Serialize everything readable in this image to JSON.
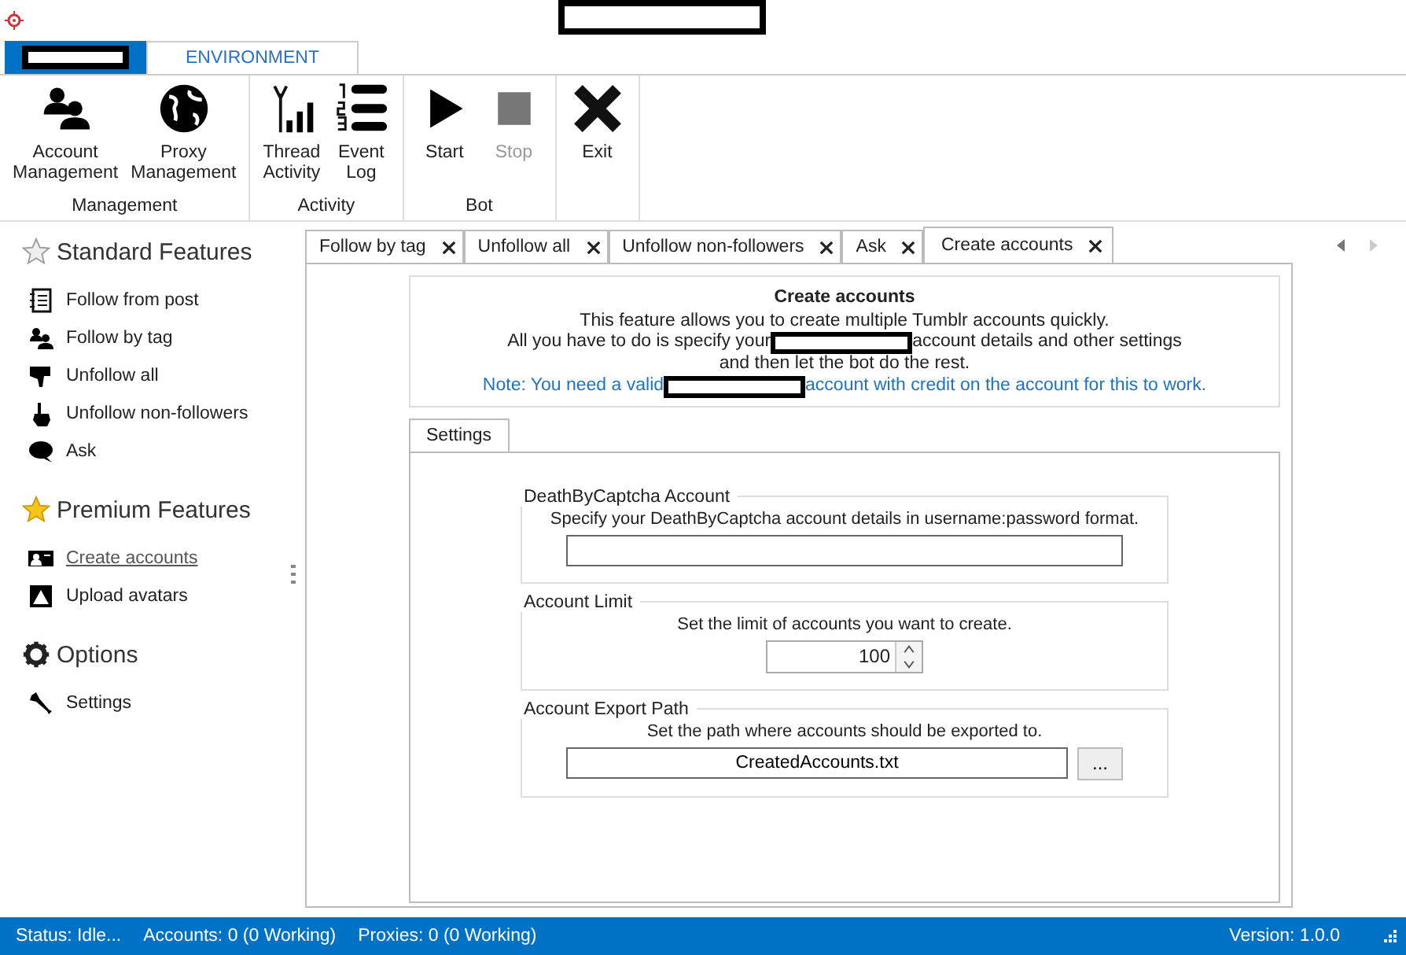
{
  "ribbon": {
    "tabs": [
      {
        "kind": "redacted",
        "selected": false
      },
      {
        "kind": "text",
        "label": "ENVIRONMENT",
        "selected": true
      }
    ],
    "groups": [
      {
        "label": "Management",
        "buttons": [
          {
            "label": "Account Management",
            "disabled": false
          },
          {
            "label": "Proxy Management",
            "disabled": false
          }
        ]
      },
      {
        "label": "Activity",
        "buttons": [
          {
            "label": "Thread Activity",
            "disabled": false
          },
          {
            "label": "Event Log",
            "disabled": false
          }
        ]
      },
      {
        "label": "Bot",
        "buttons": [
          {
            "label": "Start",
            "disabled": false
          },
          {
            "label": "Stop",
            "disabled": true
          }
        ]
      },
      {
        "buttons": [
          {
            "label": "Exit",
            "disabled": false
          }
        ]
      }
    ]
  },
  "sidebar": {
    "sections": [
      {
        "title": "Standard Features",
        "items": [
          {
            "label": "Follow from post",
            "selected": false
          },
          {
            "label": "Follow by tag",
            "selected": false
          },
          {
            "label": "Unfollow all",
            "selected": false
          },
          {
            "label": "Unfollow non-followers",
            "selected": false
          },
          {
            "label": "Ask",
            "selected": false
          }
        ]
      },
      {
        "title": "Premium Features",
        "items": [
          {
            "label": "Create accounts",
            "selected": true
          },
          {
            "label": "Upload avatars",
            "selected": false
          }
        ]
      },
      {
        "title": "Options",
        "items": [
          {
            "label": "Settings",
            "selected": false
          }
        ]
      }
    ]
  },
  "doc_tabs": [
    {
      "label": "Follow by tag",
      "selected": false
    },
    {
      "label": "Unfollow all",
      "selected": false
    },
    {
      "label": "Unfollow non-followers",
      "selected": false
    },
    {
      "label": "Ask",
      "selected": false
    },
    {
      "label": "Create accounts",
      "selected": true
    }
  ],
  "info": {
    "title": "Create accounts",
    "line_1": "This feature allows you to create multiple Tumblr accounts quickly.",
    "line_2_start": "All you have to do is specify your",
    "line_2_end": "account details and other settings",
    "line_3": "and then let the bot do the rest.",
    "note_start": "Note: You need a valid",
    "note_end": "account with credit on the account for this to work."
  },
  "settings_tab": {
    "label": "Settings",
    "selected": true
  },
  "groups": [
    {
      "kind": "text",
      "title": "DeathByCaptcha Account",
      "description": "Specify your DeathByCaptcha account details in username:password format."
    },
    {
      "kind": "number",
      "title": "Account Limit",
      "description": "Set the limit of accounts you want to create.",
      "value": "100"
    },
    {
      "kind": "path",
      "title": "Account Export Path",
      "description": "Set the path where accounts should be exported to.",
      "value": "CreatedAccounts.txt",
      "button": "..."
    }
  ],
  "status_bar": {
    "status": "Status: Idle...",
    "accounts": "Accounts: 0 (0 Working)",
    "proxies": "Proxies: 0 (0 Working)",
    "version": "Version: 1.0.0"
  }
}
